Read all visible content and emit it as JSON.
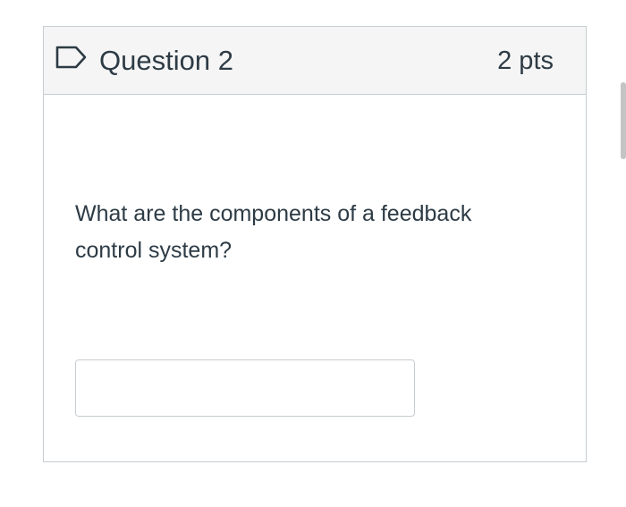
{
  "question": {
    "title": "Question 2",
    "points": "2 pts",
    "text": "What are the components of a feedback control system?",
    "flag_icon": "flag-bookmark-icon",
    "answer": {
      "value": "",
      "placeholder": ""
    }
  },
  "colors": {
    "text": "#2d3b45",
    "border": "#c7cdd1",
    "header_bg": "#f5f5f5",
    "flag": "#2d3b45"
  }
}
